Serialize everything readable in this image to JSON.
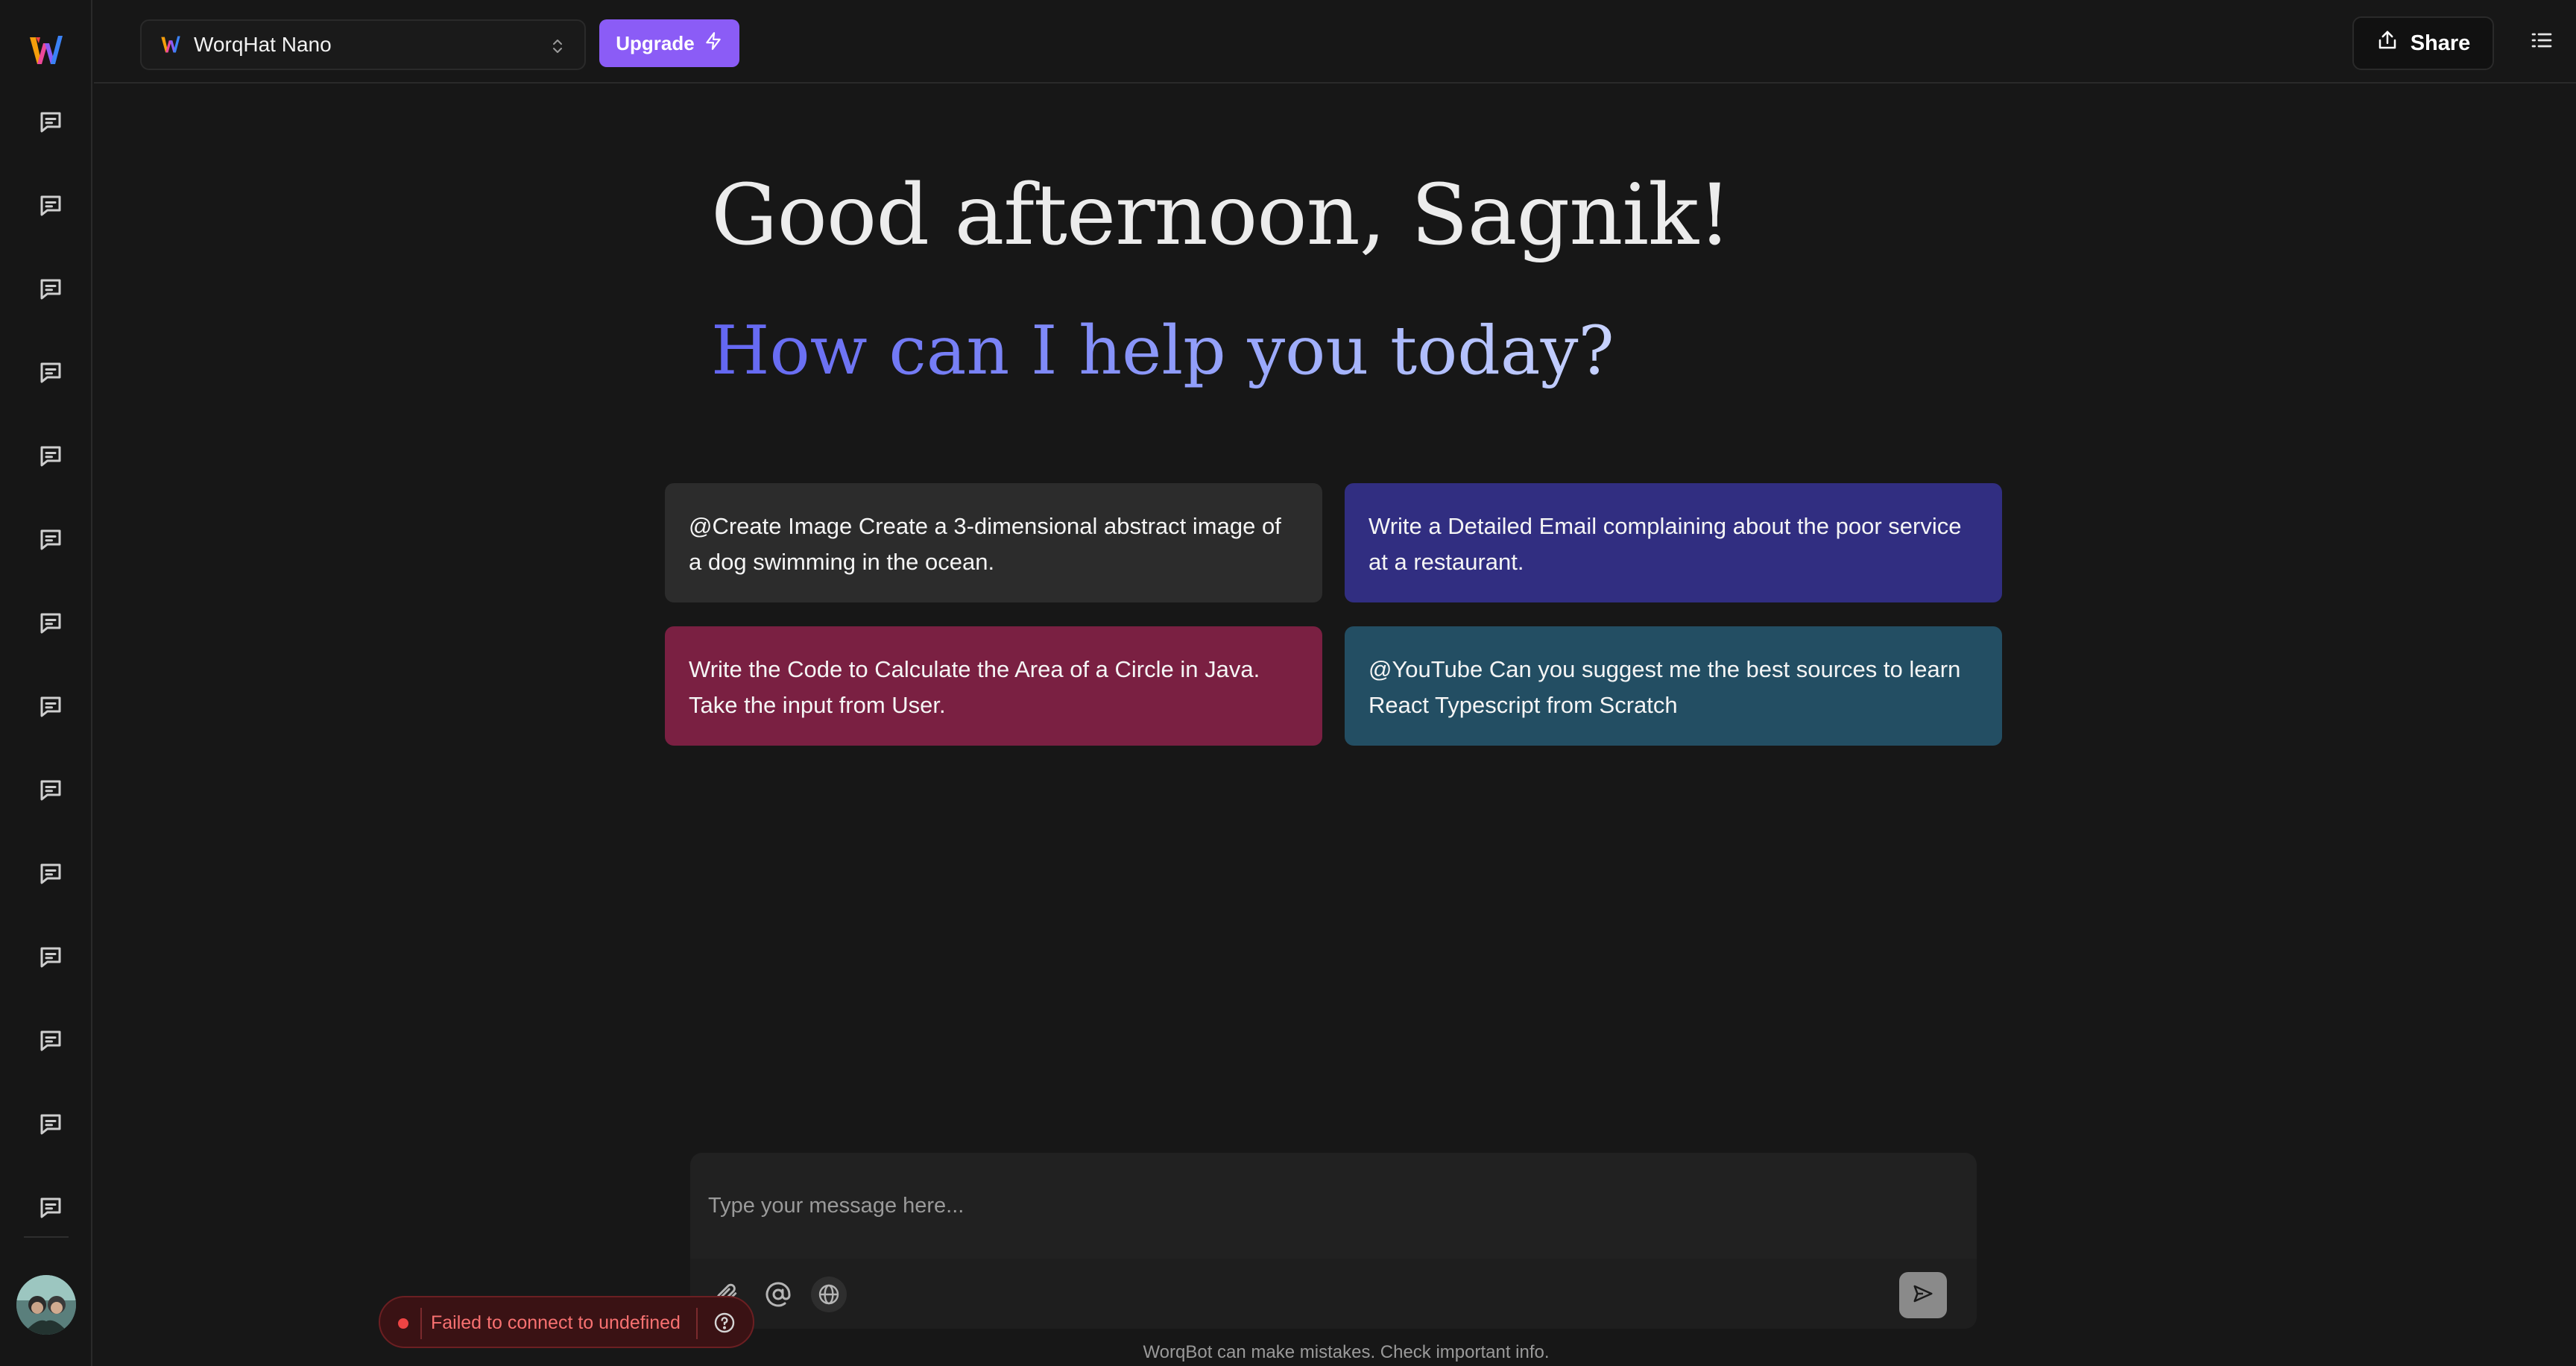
{
  "colors": {
    "background": "#171717",
    "accent": "#8b5cf6",
    "card_dark": "#2c2c2c",
    "card_indigo": "#312e81",
    "card_crimson": "#7a2042",
    "card_teal": "#234e63",
    "error": "#f87171"
  },
  "sidebar": {
    "logo_icon": "worqhat-logo-icon",
    "chat_icons": [
      "chat-icon",
      "chat-icon",
      "chat-icon",
      "chat-icon",
      "chat-icon",
      "chat-icon",
      "chat-icon",
      "chat-icon",
      "chat-icon",
      "chat-icon",
      "chat-icon",
      "chat-icon",
      "chat-icon",
      "chat-icon"
    ],
    "avatar_icon": "user-avatar"
  },
  "header": {
    "model_name": "WorqHat Nano",
    "upgrade_label": "Upgrade",
    "share_label": "Share"
  },
  "main": {
    "greeting": "Good afternoon, Sagnik!",
    "subgreeting": "How can I help you today?",
    "suggestions": [
      "@Create Image Create a 3-dimensional abstract image of a dog swimming in the ocean.",
      "Write a Detailed Email complaining about the poor service at a restaurant.",
      "Write the Code to Calculate the Area of a Circle in Java. Take the input from User.",
      "@YouTube Can you suggest me the best sources to learn React Typescript from Scratch"
    ]
  },
  "composer": {
    "placeholder": "Type your message here...",
    "tools": [
      "paperclip-icon",
      "at-sign-icon",
      "globe-icon"
    ],
    "send_icon": "send-icon"
  },
  "toast": {
    "message": "Failed to connect to undefined"
  },
  "footer": {
    "disclaimer": "WorqBot can make mistakes. Check important info."
  }
}
